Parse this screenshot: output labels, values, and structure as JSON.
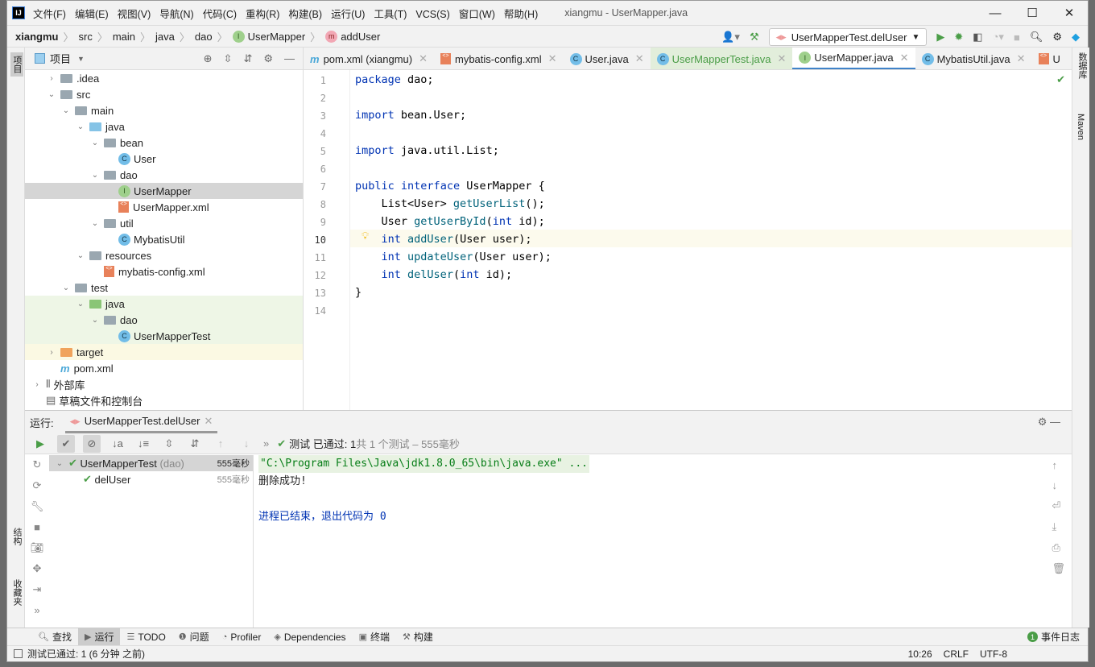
{
  "window": {
    "title": "xiangmu - UserMapper.java",
    "logo": "IJ"
  },
  "menu": [
    "文件(F)",
    "编辑(E)",
    "视图(V)",
    "导航(N)",
    "代码(C)",
    "重构(R)",
    "构建(B)",
    "运行(U)",
    "工具(T)",
    "VCS(S)",
    "窗口(W)",
    "帮助(H)"
  ],
  "breadcrumb": [
    "xiangmu",
    "src",
    "main",
    "java",
    "dao",
    "UserMapper",
    "addUser"
  ],
  "toolbar": {
    "run_config": "UserMapperTest.delUser"
  },
  "left_strip": {
    "project": "项目",
    "structure": "结构",
    "favorites": "收藏夹"
  },
  "right_strip": {
    "database": "数据库",
    "maven": "Maven"
  },
  "project": {
    "title": "项目",
    "tree": [
      {
        "label": ".idea",
        "depth": 1,
        "arrow": "›",
        "icon": "folder"
      },
      {
        "label": "src",
        "depth": 1,
        "arrow": "⌄",
        "icon": "folder"
      },
      {
        "label": "main",
        "depth": 2,
        "arrow": "⌄",
        "icon": "folder"
      },
      {
        "label": "java",
        "depth": 3,
        "arrow": "⌄",
        "icon": "folder-blue"
      },
      {
        "label": "bean",
        "depth": 4,
        "arrow": "⌄",
        "icon": "package"
      },
      {
        "label": "User",
        "depth": 5,
        "arrow": "",
        "icon": "class"
      },
      {
        "label": "dao",
        "depth": 4,
        "arrow": "⌄",
        "icon": "package"
      },
      {
        "label": "UserMapper",
        "depth": 5,
        "arrow": "",
        "icon": "interface"
      },
      {
        "label": "UserMapper.xml",
        "depth": 5,
        "arrow": "",
        "icon": "xml"
      },
      {
        "label": "util",
        "depth": 4,
        "arrow": "⌄",
        "icon": "package"
      },
      {
        "label": "MybatisUtil",
        "depth": 5,
        "arrow": "",
        "icon": "class"
      },
      {
        "label": "resources",
        "depth": 3,
        "arrow": "⌄",
        "icon": "folder"
      },
      {
        "label": "mybatis-config.xml",
        "depth": 4,
        "arrow": "",
        "icon": "xml"
      },
      {
        "label": "test",
        "depth": 2,
        "arrow": "⌄",
        "icon": "folder"
      },
      {
        "label": "java",
        "depth": 3,
        "arrow": "⌄",
        "icon": "folder-green"
      },
      {
        "label": "dao",
        "depth": 4,
        "arrow": "⌄",
        "icon": "package"
      },
      {
        "label": "UserMapperTest",
        "depth": 5,
        "arrow": "",
        "icon": "class"
      },
      {
        "label": "target",
        "depth": 1,
        "arrow": "›",
        "icon": "folder-orange"
      },
      {
        "label": "pom.xml",
        "depth": 1,
        "arrow": "",
        "icon": "maven"
      },
      {
        "label": "外部库",
        "depth": 0,
        "arrow": "›",
        "icon": "library"
      },
      {
        "label": "草稿文件和控制台",
        "depth": 0,
        "arrow": "",
        "icon": "scratch"
      }
    ]
  },
  "tabs": [
    {
      "label": "pom.xml (xiangmu)",
      "icon": "maven"
    },
    {
      "label": "mybatis-config.xml",
      "icon": "xml"
    },
    {
      "label": "User.java",
      "icon": "class"
    },
    {
      "label": "UserMapperTest.java",
      "icon": "class"
    },
    {
      "label": "UserMapper.java",
      "icon": "interface"
    },
    {
      "label": "MybatisUtil.java",
      "icon": "class"
    },
    {
      "label": "U",
      "icon": "xml"
    }
  ],
  "editor": {
    "lines": [
      "package dao;",
      "",
      "import bean.User;",
      "",
      "import java.util.List;",
      "",
      "public interface UserMapper {",
      "    List<User> getUserList();",
      "    User getUserById(int id);",
      "    int addUser(User user);",
      "    int updateUser(User user);",
      "    int delUser(int id);",
      "}",
      ""
    ],
    "current_line": 10
  },
  "run": {
    "label": "运行:",
    "tab": "UserMapperTest.delUser",
    "status": "测试 已通过: 1",
    "status_detail": "共 1 个测试 – 555毫秒",
    "tree": [
      {
        "label": "UserMapperTest",
        "pkg": "(dao)",
        "time": "555毫秒"
      },
      {
        "label": "delUser",
        "time": "555毫秒"
      }
    ],
    "console": [
      "\"C:\\Program Files\\Java\\jdk1.8.0_65\\bin\\java.exe\" ...",
      "删除成功!",
      "",
      "进程已结束，退出代码为 0"
    ]
  },
  "bottom_tools": [
    "查找",
    "运行",
    "TODO",
    "问题",
    "Profiler",
    "Dependencies",
    "终端",
    "构建"
  ],
  "event_log": "事件日志",
  "event_count": "1",
  "status": {
    "message": "测试已通过: 1 (6 分钟 之前)",
    "position": "10:26",
    "line_sep": "CRLF",
    "encoding": "UTF-8"
  }
}
